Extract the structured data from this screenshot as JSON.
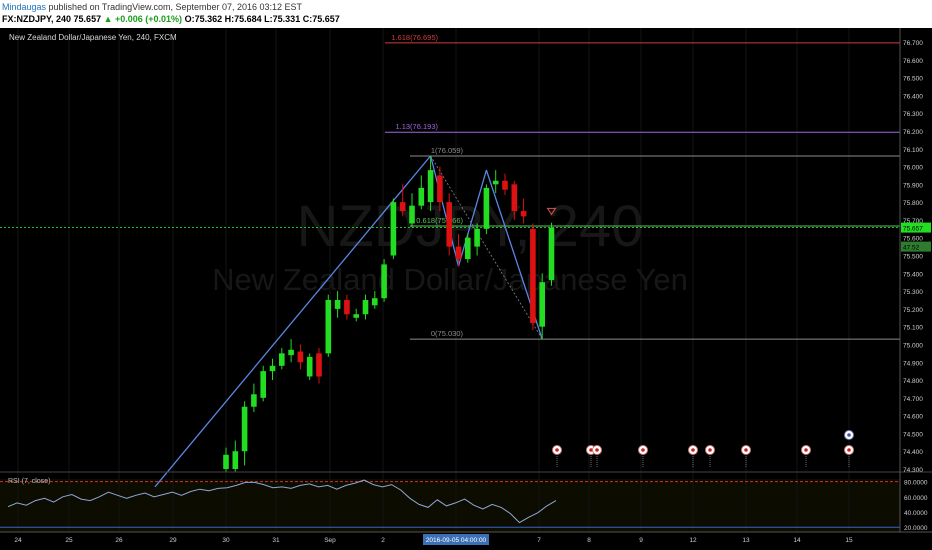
{
  "header": {
    "author": "Mindaugas",
    "published": "published on TradingView.com, September 07, 2016 03:12 EST",
    "symbol": "FX:NZDJPY, 240",
    "last": "75.657",
    "change": "▲ +0.006 (+0.01%)",
    "ohlc_o": "O:75.362",
    "ohlc_h": "H:75.684",
    "ohlc_l": "L:75.331",
    "ohlc_c": "C:75.657"
  },
  "legend_title": "New Zealand Dollar/Japanese Yen, 240, FXCM",
  "watermark": {
    "big": "NZDJPY, 240",
    "small": "New Zealand Dollar/Japanese Yen"
  },
  "colors": {
    "up": "#22dd22",
    "down": "#dd1111",
    "line": "#5b86e5",
    "rsi": "#8fa6d8",
    "bg": "#000000"
  },
  "chart_data": {
    "type": "candlestick",
    "title": "New Zealand Dollar/Japanese Yen, 240, FXCM",
    "x_tick_labels": [
      "24",
      "25",
      "26",
      "29",
      "30",
      "31",
      "Sep",
      "2",
      "2016-09-05 04:00:00",
      "7",
      "8",
      "9",
      "12",
      "13",
      "14",
      "15"
    ],
    "highlighted_x_label": "2016-09-05 04:00:00",
    "y_axis": {
      "min": 74.3,
      "max": 76.7,
      "step": 0.1
    },
    "y_tick_labels": [
      "76.700",
      "76.600",
      "76.500",
      "76.400",
      "76.300",
      "76.200",
      "76.100",
      "76.000",
      "75.900",
      "75.800",
      "75.700",
      "75.600",
      "75.500",
      "75.400",
      "75.300",
      "75.200",
      "75.100",
      "75.000",
      "74.900",
      "74.800",
      "74.700",
      "74.600",
      "74.500",
      "74.400",
      "74.300"
    ],
    "price_labels": {
      "last": "75.657",
      "secondary": "47.52"
    },
    "candles": [
      {
        "o": 74.3,
        "h": 74.42,
        "l": 74.28,
        "c": 74.38
      },
      {
        "o": 74.3,
        "h": 74.46,
        "l": 74.28,
        "c": 74.4
      },
      {
        "o": 74.4,
        "h": 74.68,
        "l": 74.32,
        "c": 74.65
      },
      {
        "o": 74.65,
        "h": 74.78,
        "l": 74.62,
        "c": 74.72
      },
      {
        "o": 74.7,
        "h": 74.88,
        "l": 74.68,
        "c": 74.85
      },
      {
        "o": 74.85,
        "h": 74.92,
        "l": 74.8,
        "c": 74.88
      },
      {
        "o": 74.88,
        "h": 74.98,
        "l": 74.86,
        "c": 74.95
      },
      {
        "o": 74.94,
        "h": 75.03,
        "l": 74.9,
        "c": 74.97
      },
      {
        "o": 74.96,
        "h": 75.0,
        "l": 74.86,
        "c": 74.9
      },
      {
        "o": 74.82,
        "h": 74.95,
        "l": 74.8,
        "c": 74.93
      },
      {
        "o": 74.95,
        "h": 74.98,
        "l": 74.78,
        "c": 74.82
      },
      {
        "o": 74.95,
        "h": 75.28,
        "l": 74.93,
        "c": 75.25
      },
      {
        "o": 75.2,
        "h": 75.3,
        "l": 75.15,
        "c": 75.25
      },
      {
        "o": 75.25,
        "h": 75.28,
        "l": 75.14,
        "c": 75.17
      },
      {
        "o": 75.15,
        "h": 75.2,
        "l": 75.13,
        "c": 75.17
      },
      {
        "o": 75.17,
        "h": 75.28,
        "l": 75.14,
        "c": 75.25
      },
      {
        "o": 75.22,
        "h": 75.3,
        "l": 75.2,
        "c": 75.26
      },
      {
        "o": 75.26,
        "h": 75.48,
        "l": 75.24,
        "c": 75.45
      },
      {
        "o": 75.5,
        "h": 75.82,
        "l": 75.48,
        "c": 75.8
      },
      {
        "o": 75.8,
        "h": 75.9,
        "l": 75.72,
        "c": 75.75
      },
      {
        "o": 75.68,
        "h": 75.85,
        "l": 75.66,
        "c": 75.78
      },
      {
        "o": 75.78,
        "h": 75.95,
        "l": 75.76,
        "c": 75.88
      },
      {
        "o": 75.8,
        "h": 76.06,
        "l": 75.75,
        "c": 75.98
      },
      {
        "o": 75.95,
        "h": 76.0,
        "l": 75.75,
        "c": 75.8
      },
      {
        "o": 75.8,
        "h": 75.85,
        "l": 75.5,
        "c": 75.55
      },
      {
        "o": 75.55,
        "h": 75.62,
        "l": 75.44,
        "c": 75.48
      },
      {
        "o": 75.48,
        "h": 75.62,
        "l": 75.46,
        "c": 75.6
      },
      {
        "o": 75.55,
        "h": 75.68,
        "l": 75.5,
        "c": 75.65
      },
      {
        "o": 75.65,
        "h": 75.9,
        "l": 75.62,
        "c": 75.88
      },
      {
        "o": 75.9,
        "h": 75.98,
        "l": 75.85,
        "c": 75.92
      },
      {
        "o": 75.92,
        "h": 75.96,
        "l": 75.84,
        "c": 75.87
      },
      {
        "o": 75.9,
        "h": 75.92,
        "l": 75.7,
        "c": 75.75
      },
      {
        "o": 75.75,
        "h": 75.82,
        "l": 75.68,
        "c": 75.72
      },
      {
        "o": 75.65,
        "h": 75.68,
        "l": 75.08,
        "c": 75.12
      },
      {
        "o": 75.1,
        "h": 75.4,
        "l": 75.03,
        "c": 75.35
      },
      {
        "o": 75.362,
        "h": 75.684,
        "l": 75.331,
        "c": 75.657
      }
    ],
    "fib_levels": [
      {
        "label": "1.618(76.695)",
        "value": 76.695,
        "color": "#d23b3b"
      },
      {
        "label": "1.13(76.193)",
        "value": 76.193,
        "color": "#a066e0"
      },
      {
        "label": "1(76.059)",
        "value": 76.059,
        "color": "#8c8c8c"
      },
      {
        "label": "0.618(75.666)",
        "value": 75.666,
        "color": "#5fbf5f"
      },
      {
        "label": "0(75.030)",
        "value": 75.03,
        "color": "#8c8c8c"
      }
    ],
    "rsi": {
      "label": "RSI (7, close)",
      "tick_labels": [
        "80.0000",
        "60.0000",
        "40.0000",
        "20.0000"
      ],
      "y_min": 15,
      "y_max": 90,
      "values": [
        47,
        52,
        49,
        55,
        58,
        53,
        60,
        63,
        57,
        55,
        60,
        66,
        62,
        58,
        62,
        65,
        60,
        63,
        66,
        62,
        67,
        70,
        68,
        71,
        72,
        75,
        79,
        79,
        76,
        72,
        73,
        71,
        75,
        77,
        73,
        75,
        70,
        75,
        78,
        82,
        76,
        73,
        76,
        69,
        58,
        50,
        46,
        56,
        48,
        52,
        57,
        49,
        44,
        50,
        46,
        38,
        26,
        33,
        39,
        48,
        55
      ]
    }
  }
}
